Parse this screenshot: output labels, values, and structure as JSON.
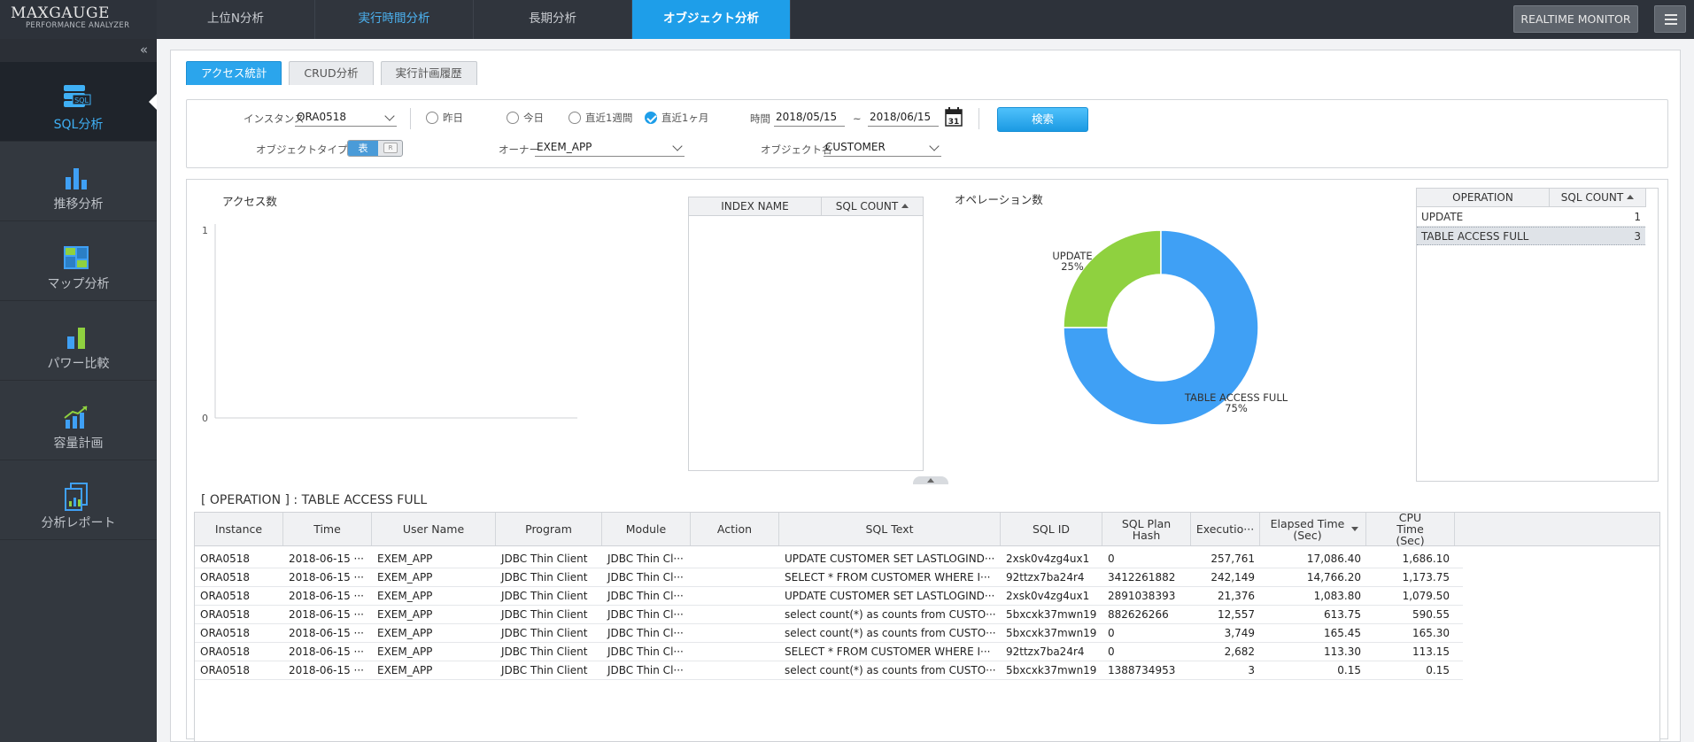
{
  "app": {
    "logo_main": "MAXGAUGE",
    "logo_sub": "PERFORMANCE ANALYZER",
    "realtime_label": "REALTIME MONITOR",
    "collapse": "«"
  },
  "nav": {
    "tabs": [
      {
        "label": "上位N分析"
      },
      {
        "label": "実行時間分析"
      },
      {
        "label": "長期分析"
      },
      {
        "label": "オブジェクト分析"
      }
    ]
  },
  "sidebar": {
    "items": [
      {
        "label": "SQL分析",
        "icon": "sql-icon"
      },
      {
        "label": "推移分析",
        "icon": "bar-chart-icon"
      },
      {
        "label": "マップ分析",
        "icon": "map-icon"
      },
      {
        "label": "パワー比較",
        "icon": "compare-icon"
      },
      {
        "label": "容量計画",
        "icon": "capacity-icon"
      },
      {
        "label": "分析レポート",
        "icon": "report-icon"
      }
    ],
    "icon_sql_text": "SQL"
  },
  "subtabs": [
    {
      "label": "アクセス統計"
    },
    {
      "label": "CRUD分析"
    },
    {
      "label": "実行計画履歴"
    }
  ],
  "filters": {
    "instance_label": "インスタンス",
    "instance_value": "ORA0518",
    "radios": [
      {
        "label": "昨日",
        "checked": false
      },
      {
        "label": "今日",
        "checked": false
      },
      {
        "label": "直近1週間",
        "checked": false
      },
      {
        "label": "直近1ヶ月",
        "checked": true
      }
    ],
    "time_label": "時間",
    "time_from": "2018/05/15",
    "time_sep": "~",
    "time_to": "2018/06/15",
    "calendar_day": "31",
    "search_label": "検索",
    "object_type_label": "オブジェクトタイプ",
    "object_type_on": "表",
    "object_type_off": "R",
    "owner_label": "オーナー",
    "owner_value": "EXEM_APP",
    "object_name_label": "オブジェクト名",
    "object_name_value": "CUSTOMER"
  },
  "access": {
    "title": "アクセス数",
    "y_top": "1",
    "y_bottom": "0"
  },
  "index_grid": {
    "col1": "INDEX NAME",
    "col2": "SQL COUNT"
  },
  "operation": {
    "title": "オペレーション数",
    "grid_col1": "OPERATION",
    "grid_col2": "SQL COUNT",
    "rows": [
      {
        "name": "UPDATE",
        "count": "1"
      },
      {
        "name": "TABLE ACCESS FULL",
        "count": "3"
      }
    ]
  },
  "chart_data": {
    "type": "pie",
    "title": "オペレーション数",
    "categories": [
      "UPDATE",
      "TABLE ACCESS FULL"
    ],
    "values": [
      25,
      75
    ],
    "labels": [
      "25%",
      "75%"
    ],
    "colors": [
      "#8fd13f",
      "#3fa0f5"
    ]
  },
  "detail": {
    "title": "[ OPERATION ] :  TABLE ACCESS FULL",
    "columns": [
      {
        "label": "Instance"
      },
      {
        "label": "Time"
      },
      {
        "label": "User Name"
      },
      {
        "label": "Program"
      },
      {
        "label": "Module"
      },
      {
        "label": "Action"
      },
      {
        "label": "SQL Text"
      },
      {
        "label": "SQL ID"
      },
      {
        "label": "SQL Plan Hash"
      },
      {
        "label": "Executio···"
      },
      {
        "label": "Elapsed Time (Sec)"
      },
      {
        "label": "CPU Time (Sec)"
      }
    ],
    "rows": [
      [
        "ORA0518",
        "2018-06-15 ···",
        "EXEM_APP",
        "JDBC Thin Client",
        "JDBC Thin Cl···",
        "",
        "UPDATE CUSTOMER SET LASTLOGIND···",
        "2xsk0v4zg4ux1",
        "0",
        "257,761",
        "17,086.40",
        "1,686.10"
      ],
      [
        "ORA0518",
        "2018-06-15 ···",
        "EXEM_APP",
        "JDBC Thin Client",
        "JDBC Thin Cl···",
        "",
        "SELECT * FROM CUSTOMER WHERE I···",
        "92ttzx7ba24r4",
        "3412261882",
        "242,149",
        "14,766.20",
        "1,173.75"
      ],
      [
        "ORA0518",
        "2018-06-15 ···",
        "EXEM_APP",
        "JDBC Thin Client",
        "JDBC Thin Cl···",
        "",
        "UPDATE CUSTOMER SET LASTLOGIND···",
        "2xsk0v4zg4ux1",
        "2891038393",
        "21,376",
        "1,083.80",
        "1,079.50"
      ],
      [
        "ORA0518",
        "2018-06-15 ···",
        "EXEM_APP",
        "JDBC Thin Client",
        "JDBC Thin Cl···",
        "",
        "select count(*) as counts from CUSTO···",
        "5bxcxk37mwn19",
        "882626266",
        "12,557",
        "613.75",
        "590.55"
      ],
      [
        "ORA0518",
        "2018-06-15 ···",
        "EXEM_APP",
        "JDBC Thin Client",
        "JDBC Thin Cl···",
        "",
        "select count(*) as counts from CUSTO···",
        "5bxcxk37mwn19",
        "0",
        "3,749",
        "165.45",
        "165.30"
      ],
      [
        "ORA0518",
        "2018-06-15 ···",
        "EXEM_APP",
        "JDBC Thin Client",
        "JDBC Thin Cl···",
        "",
        "SELECT * FROM CUSTOMER WHERE I···",
        "92ttzx7ba24r4",
        "0",
        "2,682",
        "113.30",
        "113.15"
      ],
      [
        "ORA0518",
        "2018-06-15 ···",
        "EXEM_APP",
        "JDBC Thin Client",
        "JDBC Thin Cl···",
        "",
        "select count(*) as counts from CUSTO···",
        "5bxcxk37mwn19",
        "1388734953",
        "3",
        "0.15",
        "0.15"
      ]
    ]
  }
}
